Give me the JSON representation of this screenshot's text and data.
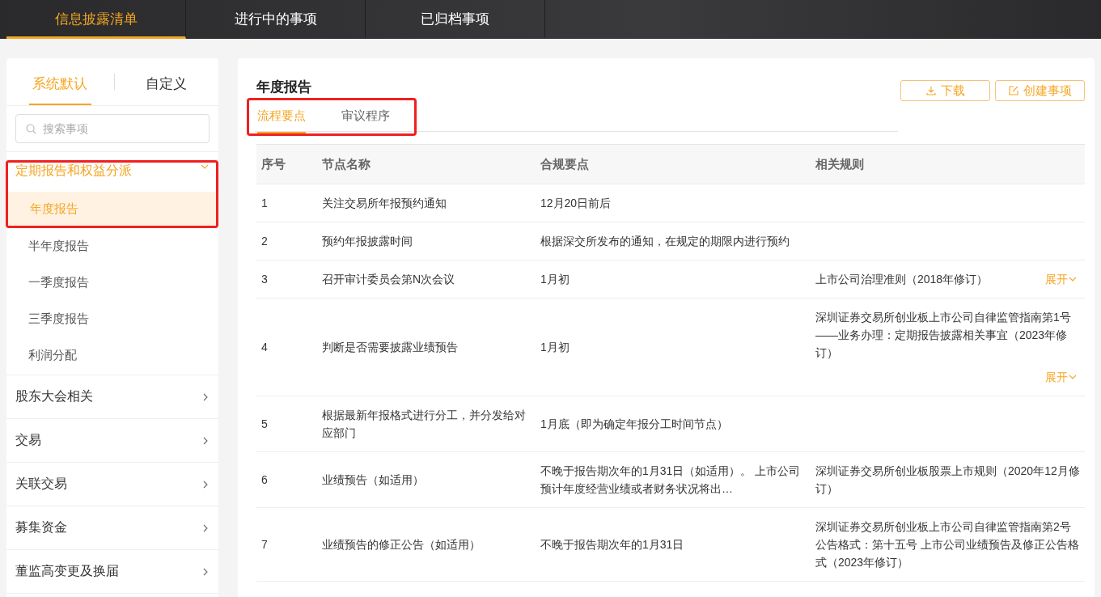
{
  "top_tabs": [
    {
      "label": "信息披露清单",
      "selected": true
    },
    {
      "label": "进行中的事项",
      "selected": false
    },
    {
      "label": "已归档事项",
      "selected": false
    }
  ],
  "sidebar": {
    "tabs": [
      {
        "label": "系统默认",
        "selected": true
      },
      {
        "label": "自定义",
        "selected": false
      }
    ],
    "search": {
      "placeholder": "搜索事项"
    },
    "groups": [
      {
        "label": "定期报告和权益分派",
        "expanded": true,
        "highlighted": true,
        "children": [
          {
            "label": "年度报告",
            "selected": true
          },
          {
            "label": "半年度报告",
            "selected": false
          },
          {
            "label": "一季度报告",
            "selected": false
          },
          {
            "label": "三季度报告",
            "selected": false
          },
          {
            "label": "利润分配",
            "selected": false
          }
        ]
      },
      {
        "label": "股东大会相关",
        "expanded": false,
        "highlighted": false
      },
      {
        "label": "交易",
        "expanded": false,
        "highlighted": false
      },
      {
        "label": "关联交易",
        "expanded": false,
        "highlighted": false
      },
      {
        "label": "募集资金",
        "expanded": false,
        "highlighted": false
      },
      {
        "label": "董监高变更及换届",
        "expanded": false,
        "highlighted": false
      }
    ]
  },
  "main": {
    "title": "年度报告",
    "buttons": [
      {
        "label": "下载",
        "kind": "download"
      },
      {
        "label": "创建事项",
        "kind": "create"
      }
    ],
    "tabs_highlighted": true,
    "tabs": [
      {
        "label": "流程要点",
        "selected": true
      },
      {
        "label": "审议程序",
        "selected": false
      }
    ],
    "table": {
      "columns": [
        "序号",
        "节点名称",
        "合规要点",
        "相关规则"
      ],
      "rows": [
        {
          "no": "1",
          "name": "关注交易所年报预约通知",
          "point": "12月20日前后"
        },
        {
          "no": "2",
          "name": "预约年报披露时间",
          "point": "根据深交所发布的通知，在规定的期限内进行预约"
        },
        {
          "no": "3",
          "name": "召开审计委员会第N次会议",
          "point": "1月初",
          "rule": "上市公司治理准则（2018年修订）",
          "expand": "展开",
          "kind": "inline"
        },
        {
          "no": "4",
          "name": "判断是否需要披露业绩预告",
          "point": "1月初",
          "rule": "深圳证券交易所创业板上市公司自律监管指南第1号——业务办理：定期报告披露相关事宜（2023年修订）",
          "expand": "展开",
          "kind": "below"
        },
        {
          "no": "5",
          "name": "根据最新年报格式进行分工，并分发给对应部门",
          "point": "1月底（即为确定年报分工时间节点）"
        },
        {
          "no": "6",
          "name": "业绩预告（如适用）",
          "point": "不晚于报告期次年的1月31日（如适用）。 上市公司预计年度经营业绩或者财务状况将出…",
          "rule": "深圳证券交易所创业板股票上市规则（2020年12月修订）"
        },
        {
          "no": "7",
          "name": "业绩预告的修正公告（如适用）",
          "point": "不晚于报告期次年的1月31日",
          "rule": "深圳证券交易所创业板上市公司自律监管指南第2号公告格式：第十五号 上市公司业绩预告及修正公告格式（2023年修订）"
        }
      ]
    }
  }
}
